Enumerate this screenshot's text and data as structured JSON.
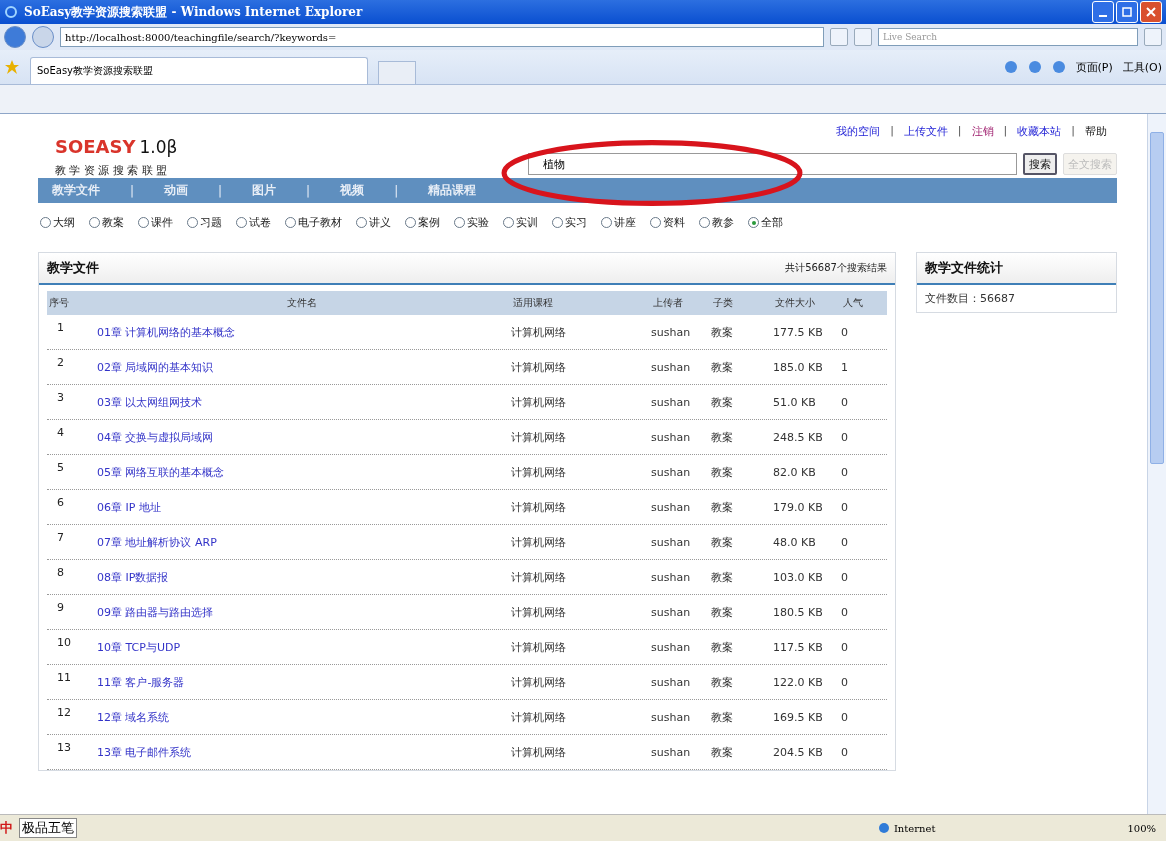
{
  "window": {
    "title": "SoEasy教学资源搜索联盟 - Windows Internet Explorer"
  },
  "address_bar": {
    "url": "http://localhost:8000/teachingfile/search/?keywords=",
    "search_placeholder": "Live Search"
  },
  "tab": {
    "title": "SoEasy教学资源搜索联盟"
  },
  "command_bar": {
    "page": "页面(P)",
    "tools": "工具(O)"
  },
  "page": {
    "logo": {
      "brand": "SOEASY",
      "version": "1.0β",
      "subtitle": "教 学 资 源 搜 索 联 盟"
    },
    "top_links": {
      "separator": "|",
      "items": [
        {
          "label": "我的空间",
          "kind": "link"
        },
        {
          "label": "上传文件",
          "kind": "link"
        },
        {
          "label": "注销",
          "kind": "visited"
        },
        {
          "label": "收藏本站",
          "kind": "link"
        },
        {
          "label": "帮助",
          "kind": "plain"
        }
      ]
    },
    "search": {
      "value": "植物",
      "button": "搜索",
      "fulltext_button": "全文搜索",
      "fulltext_disabled": true
    },
    "nav": {
      "separator": "|",
      "items": [
        "教学文件",
        "动画",
        "图片",
        "视频",
        "精品课程"
      ]
    },
    "filters": [
      {
        "label": "大纲",
        "selected": false
      },
      {
        "label": "教案",
        "selected": false
      },
      {
        "label": "课件",
        "selected": false
      },
      {
        "label": "习题",
        "selected": false
      },
      {
        "label": "试卷",
        "selected": false
      },
      {
        "label": "电子教材",
        "selected": false
      },
      {
        "label": "讲义",
        "selected": false
      },
      {
        "label": "案例",
        "selected": false
      },
      {
        "label": "实验",
        "selected": false
      },
      {
        "label": "实训",
        "selected": false
      },
      {
        "label": "实习",
        "selected": false
      },
      {
        "label": "讲座",
        "selected": false
      },
      {
        "label": "资料",
        "selected": false
      },
      {
        "label": "教参",
        "selected": false
      },
      {
        "label": "全部",
        "selected": true
      }
    ],
    "results": {
      "title": "教学文件",
      "count": "共计56687个搜索结果",
      "columns": [
        "序号",
        "文件名",
        "适用课程",
        "上传者",
        "子类",
        "文件大小",
        "人气"
      ],
      "rows": [
        {
          "no": "1",
          "name": "01章 计算机网络的基本概念",
          "course": "计算机网络",
          "uploader": "sushan",
          "type": "教案",
          "size": "177.5 KB",
          "views": "0"
        },
        {
          "no": "2",
          "name": "02章 局域网的基本知识",
          "course": "计算机网络",
          "uploader": "sushan",
          "type": "教案",
          "size": "185.0 KB",
          "views": "1"
        },
        {
          "no": "3",
          "name": "03章 以太网组网技术",
          "course": "计算机网络",
          "uploader": "sushan",
          "type": "教案",
          "size": "51.0 KB",
          "views": "0"
        },
        {
          "no": "4",
          "name": "04章 交换与虚拟局域网",
          "course": "计算机网络",
          "uploader": "sushan",
          "type": "教案",
          "size": "248.5 KB",
          "views": "0"
        },
        {
          "no": "5",
          "name": "05章 网络互联的基本概念",
          "course": "计算机网络",
          "uploader": "sushan",
          "type": "教案",
          "size": "82.0 KB",
          "views": "0"
        },
        {
          "no": "6",
          "name": "06章 IP 地址",
          "course": "计算机网络",
          "uploader": "sushan",
          "type": "教案",
          "size": "179.0 KB",
          "views": "0"
        },
        {
          "no": "7",
          "name": "07章 地址解析协议 ARP",
          "course": "计算机网络",
          "uploader": "sushan",
          "type": "教案",
          "size": "48.0 KB",
          "views": "0"
        },
        {
          "no": "8",
          "name": "08章 IP数据报",
          "course": "计算机网络",
          "uploader": "sushan",
          "type": "教案",
          "size": "103.0 KB",
          "views": "0"
        },
        {
          "no": "9",
          "name": "09章 路由器与路由选择",
          "course": "计算机网络",
          "uploader": "sushan",
          "type": "教案",
          "size": "180.5 KB",
          "views": "0"
        },
        {
          "no": "10",
          "name": "10章 TCP与UDP",
          "course": "计算机网络",
          "uploader": "sushan",
          "type": "教案",
          "size": "117.5 KB",
          "views": "0"
        },
        {
          "no": "11",
          "name": "11章 客户-服务器",
          "course": "计算机网络",
          "uploader": "sushan",
          "type": "教案",
          "size": "122.0 KB",
          "views": "0"
        },
        {
          "no": "12",
          "name": "12章 域名系统",
          "course": "计算机网络",
          "uploader": "sushan",
          "type": "教案",
          "size": "169.5 KB",
          "views": "0"
        },
        {
          "no": "13",
          "name": "13章 电子邮件系统",
          "course": "计算机网络",
          "uploader": "sushan",
          "type": "教案",
          "size": "204.5 KB",
          "views": "0"
        }
      ]
    },
    "stats": {
      "title": "教学文件统计",
      "file_count": "文件数目：56687"
    }
  },
  "status_bar": {
    "ime": "中",
    "ime_name": "极品五笔",
    "zone": "Internet",
    "zoom": "100%"
  }
}
